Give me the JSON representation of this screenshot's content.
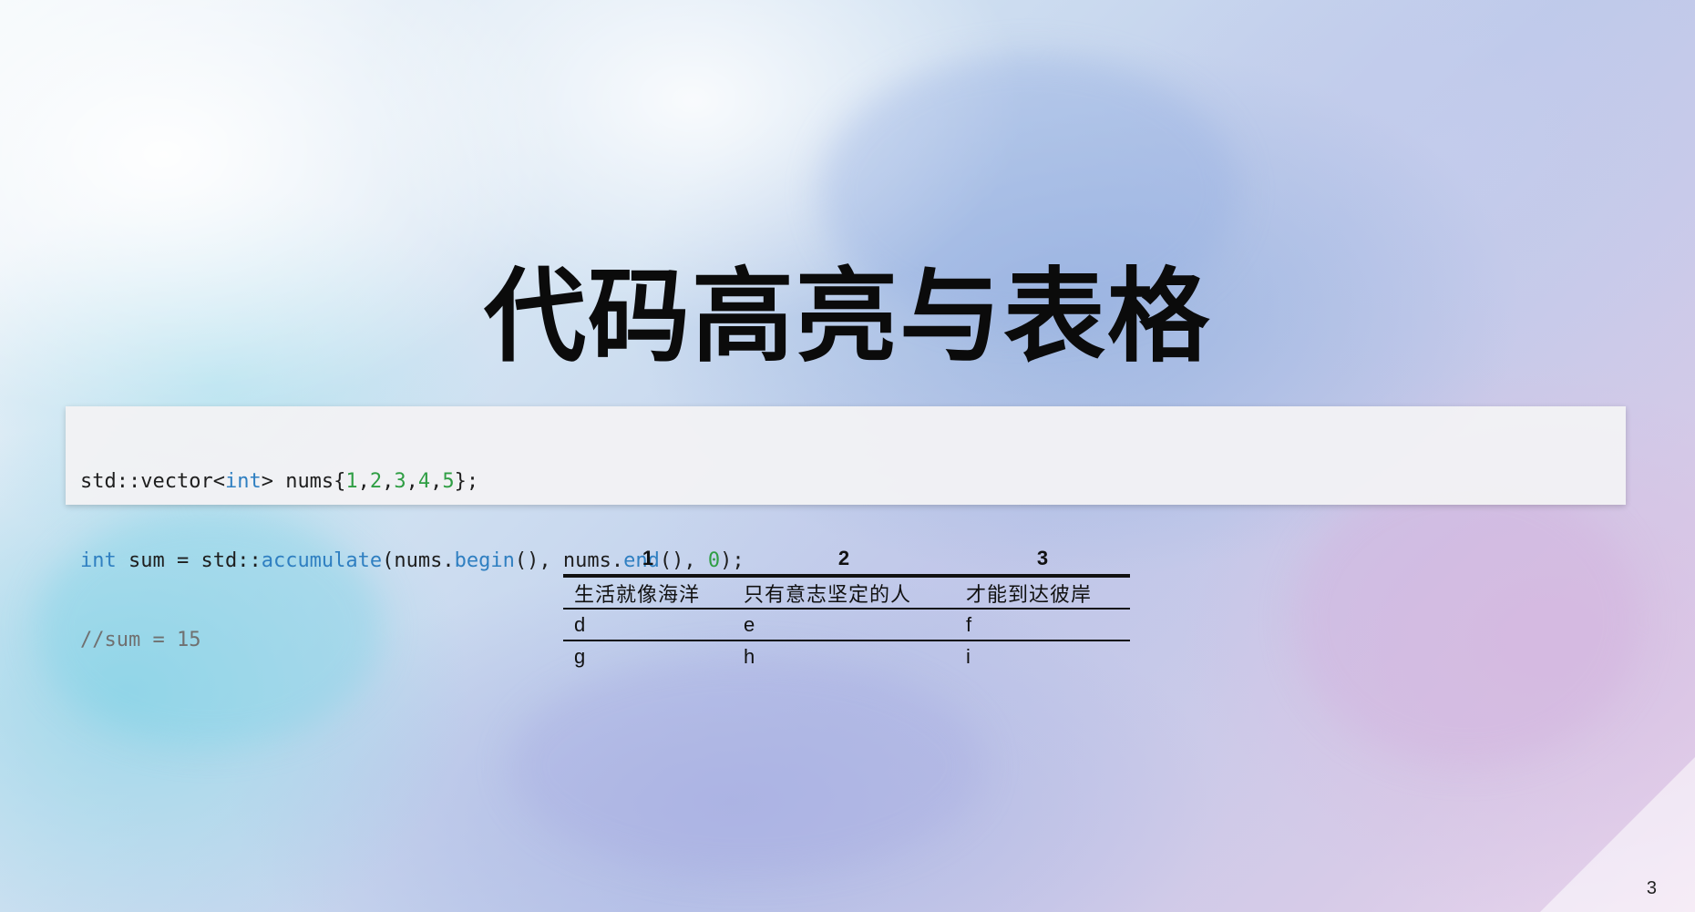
{
  "slide": {
    "title": "代码高亮与表格",
    "page_number": "3"
  },
  "code": {
    "lines": [
      [
        {
          "t": "std::vector<",
          "c": "plain"
        },
        {
          "t": "int",
          "c": "kw"
        },
        {
          "t": "> nums{",
          "c": "plain"
        },
        {
          "t": "1",
          "c": "num"
        },
        {
          "t": ",",
          "c": "plain"
        },
        {
          "t": "2",
          "c": "num"
        },
        {
          "t": ",",
          "c": "plain"
        },
        {
          "t": "3",
          "c": "num"
        },
        {
          "t": ",",
          "c": "plain"
        },
        {
          "t": "4",
          "c": "num"
        },
        {
          "t": ",",
          "c": "plain"
        },
        {
          "t": "5",
          "c": "num"
        },
        {
          "t": "};",
          "c": "plain"
        }
      ],
      [
        {
          "t": "int",
          "c": "kw"
        },
        {
          "t": " sum = std::",
          "c": "plain"
        },
        {
          "t": "accumulate",
          "c": "fn"
        },
        {
          "t": "(nums.",
          "c": "plain"
        },
        {
          "t": "begin",
          "c": "fn"
        },
        {
          "t": "(), nums.",
          "c": "plain"
        },
        {
          "t": "end",
          "c": "fn"
        },
        {
          "t": "(), ",
          "c": "plain"
        },
        {
          "t": "0",
          "c": "num"
        },
        {
          "t": ");",
          "c": "plain"
        }
      ],
      [
        {
          "t": "//sum = 15",
          "c": "comment"
        }
      ]
    ]
  },
  "table": {
    "headers": [
      "1",
      "2",
      "3"
    ],
    "rows": [
      [
        "生活就像海洋",
        "只有意志坚定的人",
        "才能到达彼岸"
      ],
      [
        "d",
        "e",
        "f"
      ],
      [
        "g",
        "h",
        "i"
      ]
    ]
  },
  "colors": {
    "keyword": "#2f7fc1",
    "number": "#2f9e44",
    "comment": "#707070",
    "code_background": "#f2f2f4"
  }
}
